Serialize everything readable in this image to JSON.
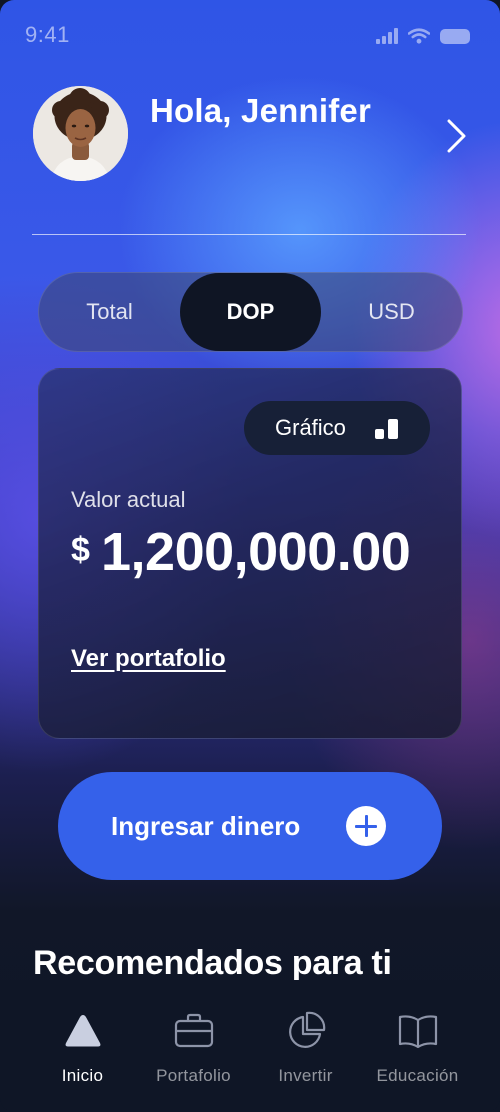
{
  "status_bar": {
    "time": "9:41"
  },
  "header": {
    "greeting": "Hola, Jennifer"
  },
  "currency_tabs": [
    {
      "label": "Total",
      "active": false
    },
    {
      "label": "DOP",
      "active": true
    },
    {
      "label": "USD",
      "active": false
    }
  ],
  "balance_card": {
    "chart_button_label": "Gráfico",
    "value_label": "Valor actual",
    "currency_symbol": "$",
    "amount": "1,200,000.00",
    "portfolio_link": "Ver portafolio"
  },
  "deposit_button": {
    "label": "Ingresar dinero"
  },
  "recommended": {
    "title": "Recomendados para ti"
  },
  "tabbar": [
    {
      "label": "Inicio",
      "icon": "home-triangle-icon",
      "active": true
    },
    {
      "label": "Portafolio",
      "icon": "briefcase-icon",
      "active": false
    },
    {
      "label": "Invertir",
      "icon": "pie-chart-icon",
      "active": false
    },
    {
      "label": "Educación",
      "icon": "book-icon",
      "active": false
    }
  ],
  "colors": {
    "accent": "#3561ea",
    "tabbar_bg": "#0f1626",
    "card_bg": "#1b2040"
  }
}
